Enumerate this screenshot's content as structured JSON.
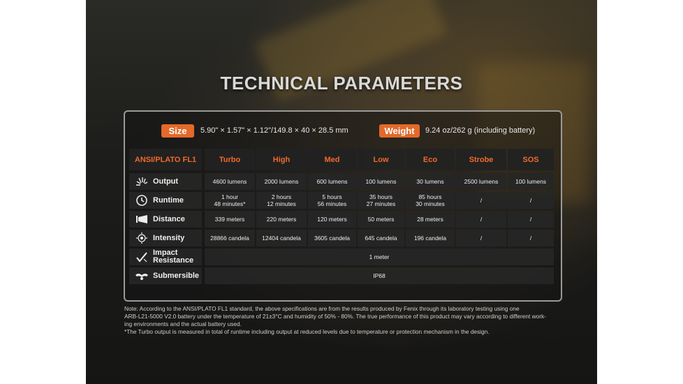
{
  "title": "TECHNICAL PARAMETERS",
  "size": {
    "label": "Size",
    "value": "5.90\" × 1.57\" × 1.12\"/149.8 × 40 × 28.5 mm"
  },
  "weight": {
    "label": "Weight",
    "value": "9.24 oz/262 g (including battery)"
  },
  "table": {
    "corner": "ANSI/PLATO FL1",
    "columns": [
      "Turbo",
      "High",
      "Med",
      "Low",
      "Eco",
      "Strobe",
      "SOS"
    ],
    "rows": [
      {
        "label": "Output",
        "icon": "light-burst-icon",
        "values": [
          "4600 lumens",
          "2000 lumens",
          "600 lumens",
          "100 lumens",
          "30 lumens",
          "2500 lumens",
          "100 lumens"
        ]
      },
      {
        "label": "Runtime",
        "icon": "clock-icon",
        "values": [
          [
            "1 hour",
            "48 minutes*"
          ],
          [
            "2 hours",
            "12 minutes"
          ],
          [
            "5 hours",
            "56 minutes"
          ],
          [
            "35 hours",
            "27 minutes"
          ],
          [
            "85 hours",
            "30 minutes"
          ],
          "/",
          "/"
        ]
      },
      {
        "label": "Distance",
        "icon": "beam-distance-icon",
        "values": [
          "339 meters",
          "220 meters",
          "120 meters",
          "50 meters",
          "28 meters",
          "/",
          "/"
        ]
      },
      {
        "label": "Intensity",
        "icon": "intensity-target-icon",
        "values": [
          "28866 candela",
          "12404 candela",
          "3605 candela",
          "645 candela",
          "196 candela",
          "/",
          "/"
        ]
      },
      {
        "label": [
          "Impact",
          "Resistance"
        ],
        "icon": "impact-check-icon",
        "span": "1 meter"
      },
      {
        "label": "Submersible",
        "icon": "waterproof-icon",
        "span": "IP68"
      }
    ]
  },
  "notes": {
    "line1": "Note: According to the ANSI/PLATO FL1 standard, the above specifications are from the results produced by Fenix through its laboratory testing using one",
    "line2": "ARB-L21-5000 V2.0 battery under the temperature of 21±3°C and humidity of 50% - 80%. The true performance of this product may vary according to different work-",
    "line3": "ing environments and the actual battery used.",
    "line4": "*The Turbo output is measured in total of runtime including output at reduced levels due to temperature or protection mechanism in the design."
  }
}
